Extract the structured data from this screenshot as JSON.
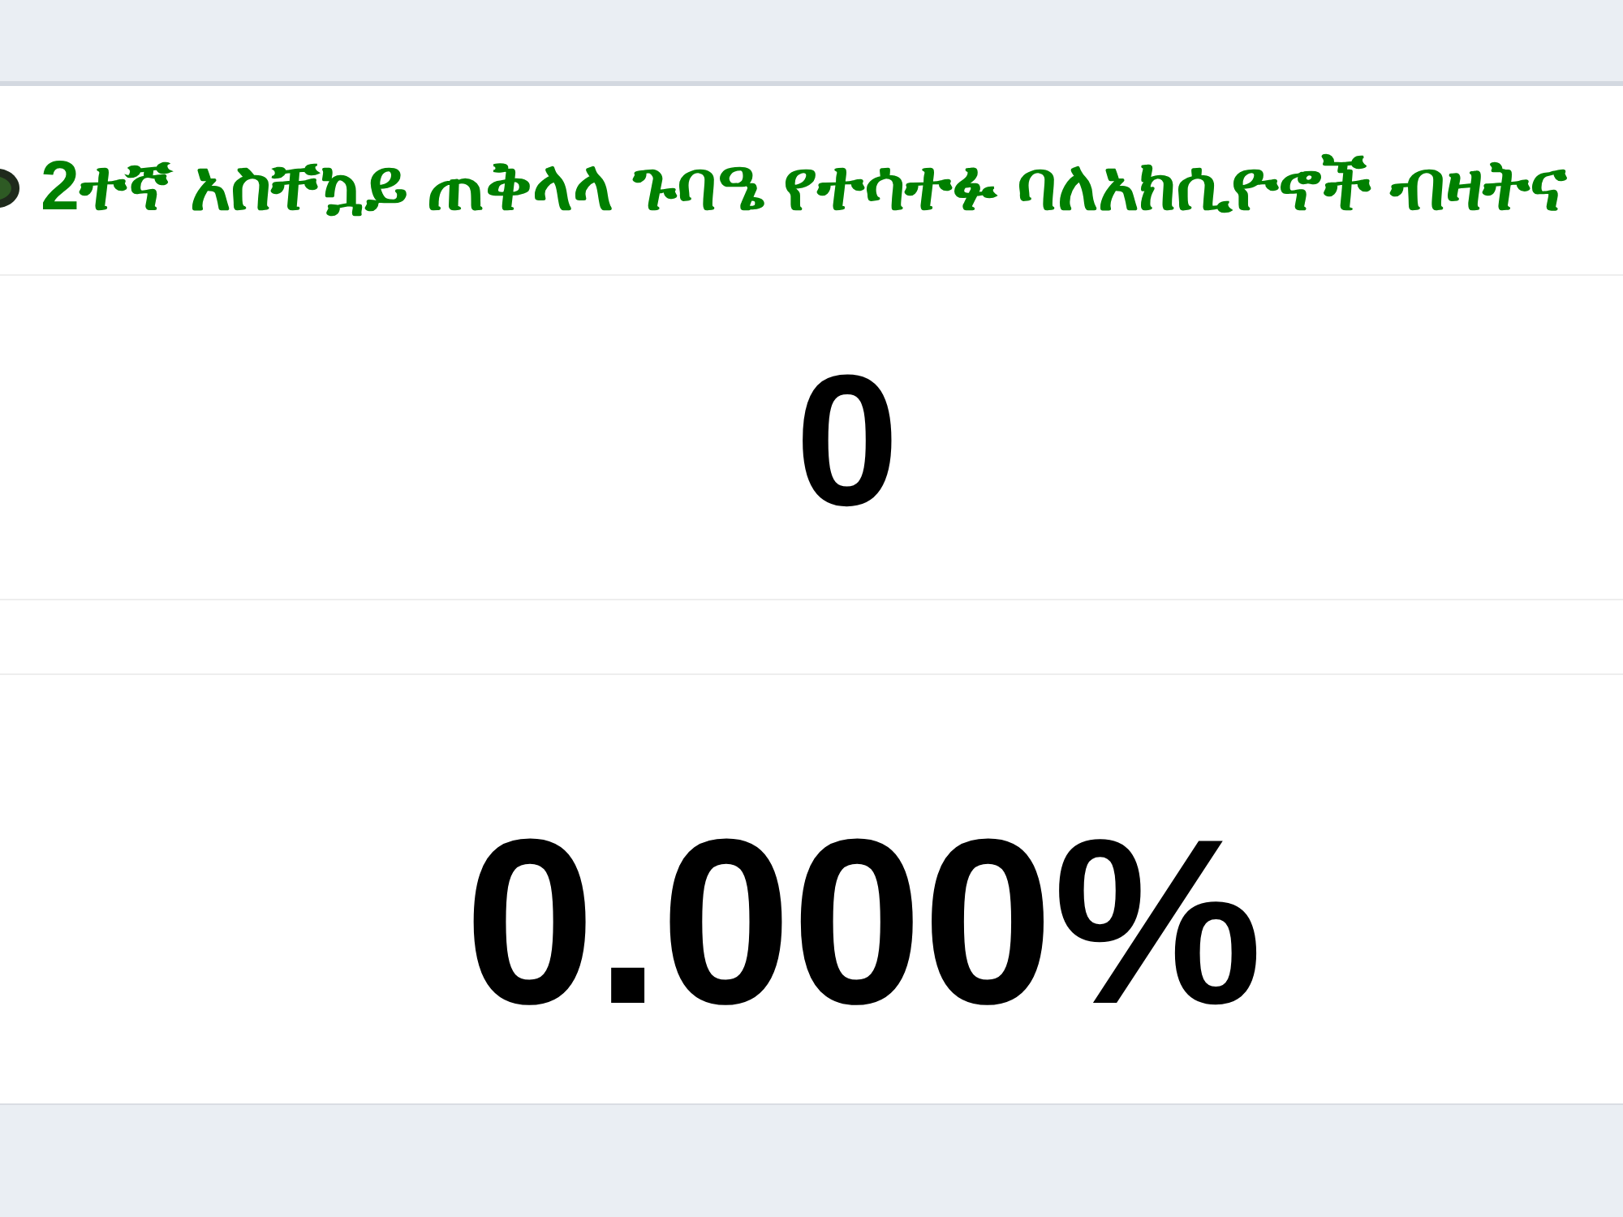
{
  "header": {
    "title": "2ተኛ አስቸኳይ ጠቅላላ ጉባዔ የተሳተፉ ባለአክሲዮኖች ብዛትና"
  },
  "stats": [
    {
      "kind": "count",
      "value": "0"
    },
    {
      "kind": "gap"
    },
    {
      "kind": "percent",
      "value": "0.000%"
    }
  ]
}
